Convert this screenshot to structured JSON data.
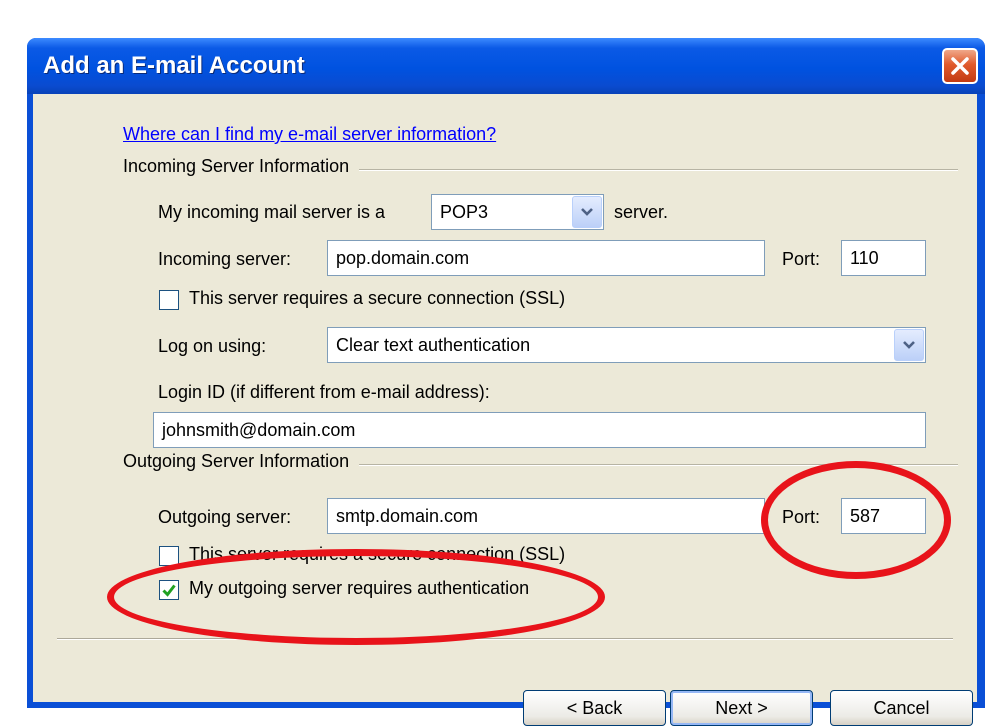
{
  "window": {
    "title": "Add an E-mail Account"
  },
  "help_link": "Where can I find my e-mail server information?",
  "incoming": {
    "group_label": "Incoming Server Information",
    "server_type_prefix": "My incoming mail server is a",
    "server_type_value": "POP3",
    "server_type_suffix": "server.",
    "server_label": "Incoming server:",
    "server_value": "pop.domain.com",
    "port_label": "Port:",
    "port_value": "110",
    "ssl_label": "This server requires a secure connection (SSL)",
    "ssl_checked": false,
    "logon_label": "Log on using:",
    "logon_value": "Clear text authentication",
    "login_id_label": "Login ID (if different from e-mail address):",
    "login_id_value": "johnsmith@domain.com"
  },
  "outgoing": {
    "group_label": "Outgoing Server Information",
    "server_label": "Outgoing server:",
    "server_value": "smtp.domain.com",
    "port_label": "Port:",
    "port_value": "587",
    "ssl_label": "This server requires a secure connection (SSL)",
    "ssl_checked": false,
    "auth_label": "My outgoing server requires authentication",
    "auth_checked": true
  },
  "buttons": {
    "back": "< Back",
    "next": "Next >",
    "cancel": "Cancel"
  },
  "colors": {
    "titlebar": "#0052e0",
    "dialog_bg": "#ece9d8",
    "annotation": "#e8131a",
    "link": "#0000ff"
  }
}
